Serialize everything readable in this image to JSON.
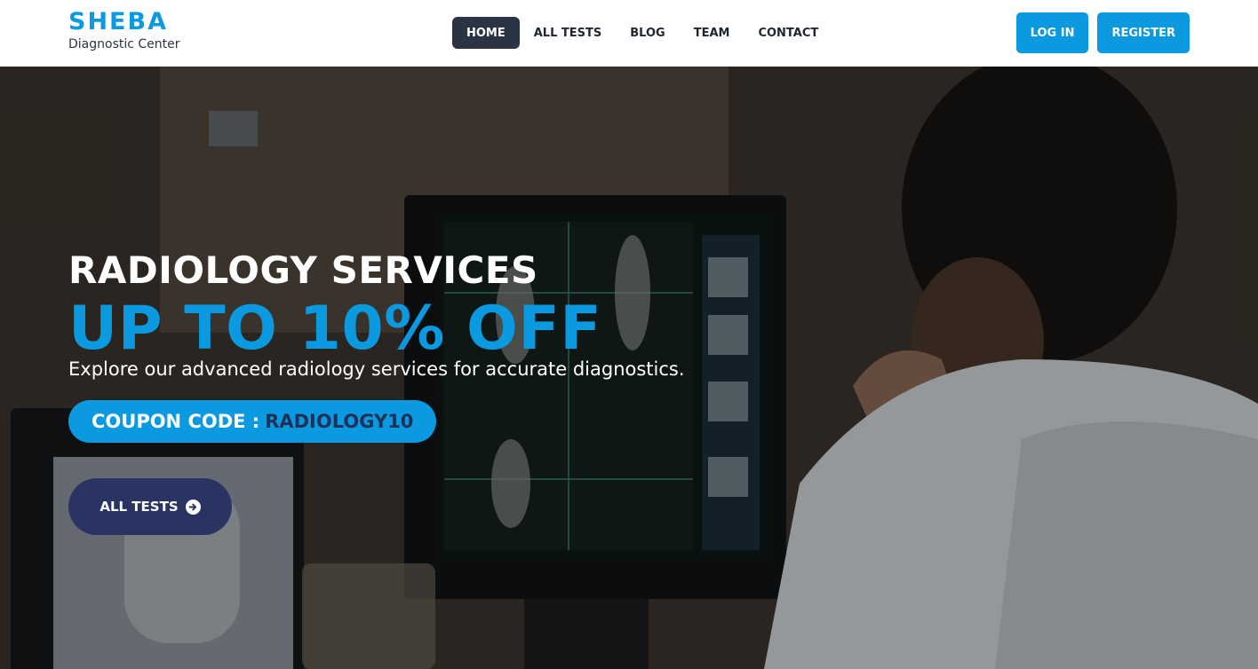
{
  "brand": {
    "name": "SHEBA",
    "subtitle": "Diagnostic Center"
  },
  "nav": {
    "items": [
      {
        "label": "HOME",
        "active": true
      },
      {
        "label": "ALL TESTS",
        "active": false
      },
      {
        "label": "BLOG",
        "active": false
      },
      {
        "label": "TEAM",
        "active": false
      },
      {
        "label": "CONTACT",
        "active": false
      }
    ]
  },
  "auth": {
    "login_label": "LOG IN",
    "register_label": "REGISTER"
  },
  "hero": {
    "title": "RADIOLOGY SERVICES",
    "offer": "UP TO 10% OFF",
    "description": "Explore our advanced radiology services for accurate diagnostics.",
    "coupon_label": "COUPON CODE :",
    "coupon_code": "RADIOLOGY10",
    "cta_label": "ALL TESTS",
    "cta_icon": "arrow-circle-right-icon"
  },
  "colors": {
    "accent": "#0b99e0",
    "nav_active_bg": "#2a3442",
    "cta_bg": "#2a3463",
    "coupon_code": "#1f3159"
  }
}
